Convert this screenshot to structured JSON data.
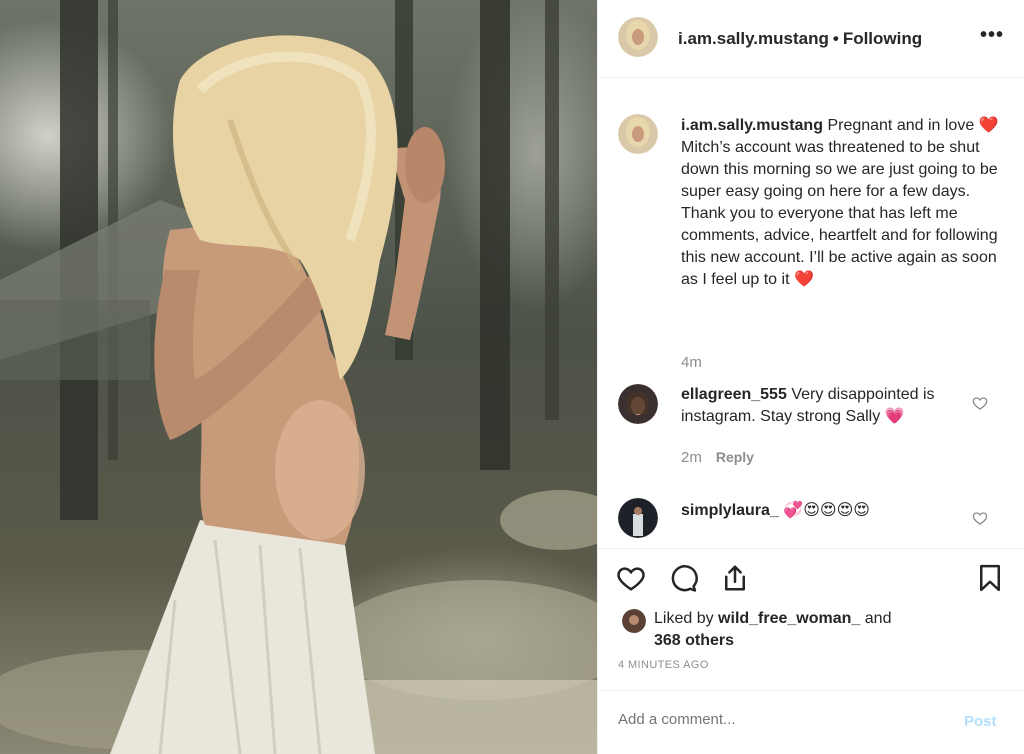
{
  "post": {
    "username": "i.am.sally.mustang",
    "follow_status": "Following",
    "more_icon": "more-options-icon",
    "caption": {
      "username": "i.am.sally.mustang",
      "text_part1": "Pregnant and in love",
      "text_part2": "Mitch’s account was threatened to be shut down this morning so we are just going to be super easy going on here for a few days. Thank you to everyone that has left me comments, advice, heartfelt and for following this new account. I’ll be active again as soon as I feel up to it",
      "emoji_heart": "❤️",
      "time": "4m"
    },
    "comments": [
      {
        "username": "ellagreen_555",
        "text": "Very disappointed is instagram. Stay strong Sally",
        "emoji": "💗",
        "time": "2m",
        "reply_label": "Reply"
      },
      {
        "username": "simplylaura_",
        "text": "",
        "emoji": "💞😍😍😍😍"
      }
    ],
    "actions": {
      "like_icon": "heart-icon",
      "comment_icon": "comment-icon",
      "share_icon": "share-icon",
      "save_icon": "bookmark-icon"
    },
    "likes": {
      "prefix": "Liked by",
      "user": "wild_free_woman_",
      "suffix": "and",
      "others": "368 others"
    },
    "timestamp": "4 MINUTES AGO",
    "add_comment": {
      "placeholder": "Add a comment...",
      "post_label": "Post"
    }
  },
  "colors": {
    "text": "#262626",
    "muted": "#8e8e8e",
    "heart_red": "#ed4956",
    "post_disabled": "#b2dffc",
    "border": "#efefef"
  }
}
